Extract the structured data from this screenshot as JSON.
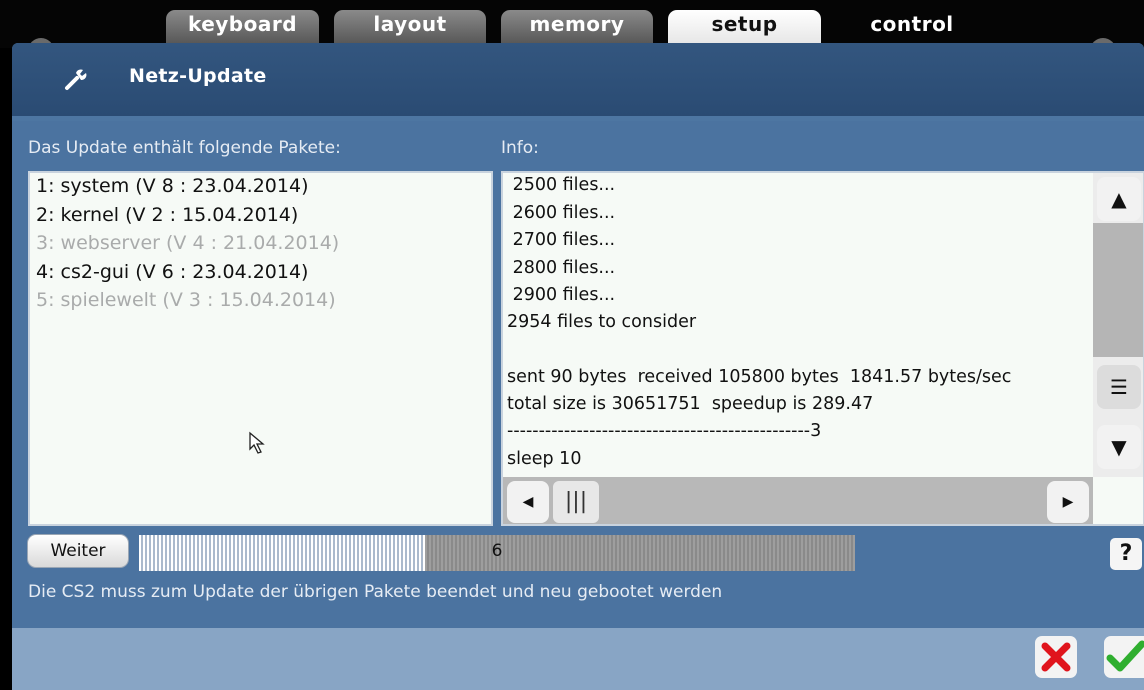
{
  "tabs": [
    {
      "label": "keyboard",
      "active": false
    },
    {
      "label": "layout",
      "active": false
    },
    {
      "label": "memory",
      "active": false
    },
    {
      "label": "setup",
      "active": true
    },
    {
      "label": "control",
      "active": false
    }
  ],
  "dialog": {
    "title": "Netz-Update",
    "title_icon": "wrench-icon"
  },
  "packages": {
    "label": "Das Update enthält folgende Pakete:",
    "items": [
      {
        "text": "1: system (V 8 : 23.04.2014)",
        "enabled": true
      },
      {
        "text": "2: kernel (V 2 : 15.04.2014)",
        "enabled": true
      },
      {
        "text": "3: webserver (V 4 : 21.04.2014)",
        "enabled": false
      },
      {
        "text": "4: cs2-gui (V 6 : 23.04.2014)",
        "enabled": true
      },
      {
        "text": "5: spielewelt (V 3 : 15.04.2014)",
        "enabled": false
      }
    ]
  },
  "info": {
    "label": "Info:",
    "lines": [
      " 2500 files...",
      " 2600 files...",
      " 2700 files...",
      " 2800 files...",
      " 2900 files...",
      "2954 files to consider",
      "",
      "sent 90 bytes  received 105800 bytes  1841.57 bytes/sec",
      "total size is 30651751  speedup is 289.47",
      "------------------------------------------------3",
      "sleep 10"
    ]
  },
  "controls": {
    "weiter_label": "Weiter",
    "progress_value": "6",
    "progress_fraction": 0.4,
    "help_label": "?"
  },
  "status_text": "Die CS2 muss zum Update der übrigen Pakete beendet und neu gebootet werden",
  "colors": {
    "dialog_bg": "#4b73a0",
    "titlebar_bg": "#2a4b73",
    "footer_bg": "#88a5c5",
    "cancel_red": "#e0141c",
    "ok_green": "#2fae2f"
  }
}
